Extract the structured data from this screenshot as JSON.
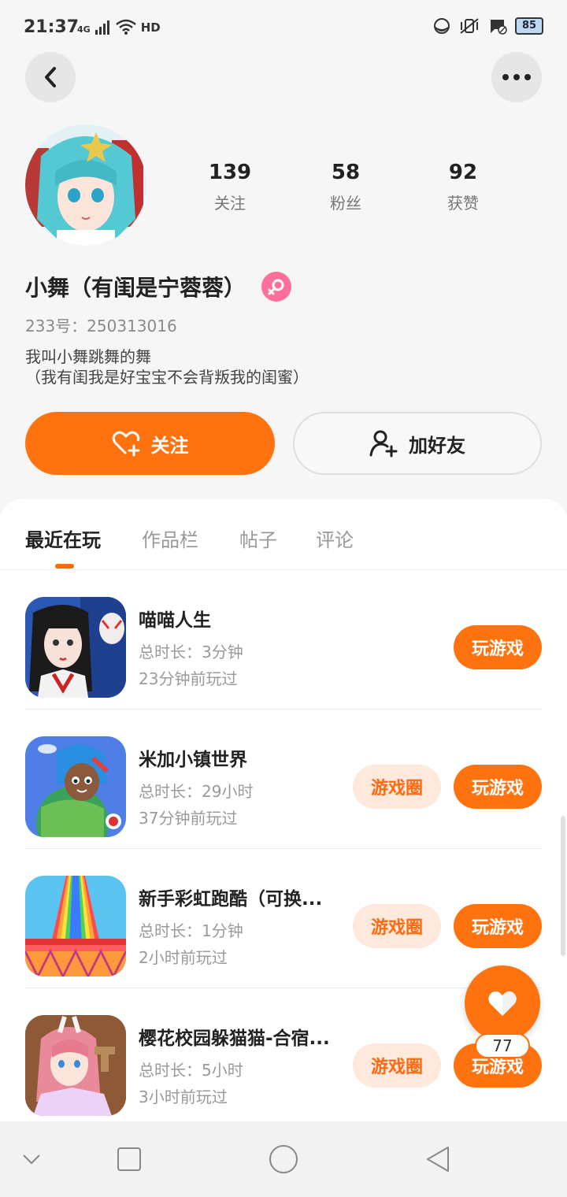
{
  "status_bar": {
    "time": "21:37",
    "network": "4G",
    "hd": "HD",
    "battery": "85"
  },
  "header": {
    "back_icon": "chevron-left-icon",
    "more_icon": "more-horizontal-icon"
  },
  "profile": {
    "stats": [
      {
        "value": "139",
        "label": "关注"
      },
      {
        "value": "58",
        "label": "粉丝"
      },
      {
        "value": "92",
        "label": "获赞"
      }
    ],
    "name": "小舞（有闺是宁蓉蓉）",
    "gender_icon": "female-icon",
    "gender_color": "#ff6f99",
    "uid": "233号：250313016",
    "bio": "我叫小舞跳舞的舞\n（我有闺我是好宝宝不会背叛我的闺蜜）"
  },
  "actions": {
    "follow_label": "关注",
    "add_friend_label": "加好友"
  },
  "tabs": [
    {
      "label": "最近在玩",
      "active": true
    },
    {
      "label": "作品栏",
      "active": false
    },
    {
      "label": "帖子",
      "active": false
    },
    {
      "label": "评论",
      "active": false
    }
  ],
  "games": [
    {
      "name": "喵喵人生",
      "duration": "总时长：3分钟",
      "last_played": "23分钟前玩过",
      "circle_label": "",
      "play_label": "玩游戏"
    },
    {
      "name": "米加小镇世界",
      "duration": "总时长：29小时",
      "last_played": "37分钟前玩过",
      "circle_label": "游戏圈",
      "play_label": "玩游戏"
    },
    {
      "name": "新手彩虹跑酷（可换...",
      "duration": "总时长：1分钟",
      "last_played": "2小时前玩过",
      "circle_label": "游戏圈",
      "play_label": "玩游戏"
    },
    {
      "name": "樱花校园躲猫猫-合宿...",
      "duration": "总时长：5小时",
      "last_played": "3小时前玩过",
      "circle_label": "游戏圈",
      "play_label": "玩游戏"
    }
  ],
  "like_fab": {
    "icon": "heart-icon",
    "count": "77"
  },
  "colors": {
    "accent": "#ff7210",
    "accent_light": "#ffe8dc"
  }
}
